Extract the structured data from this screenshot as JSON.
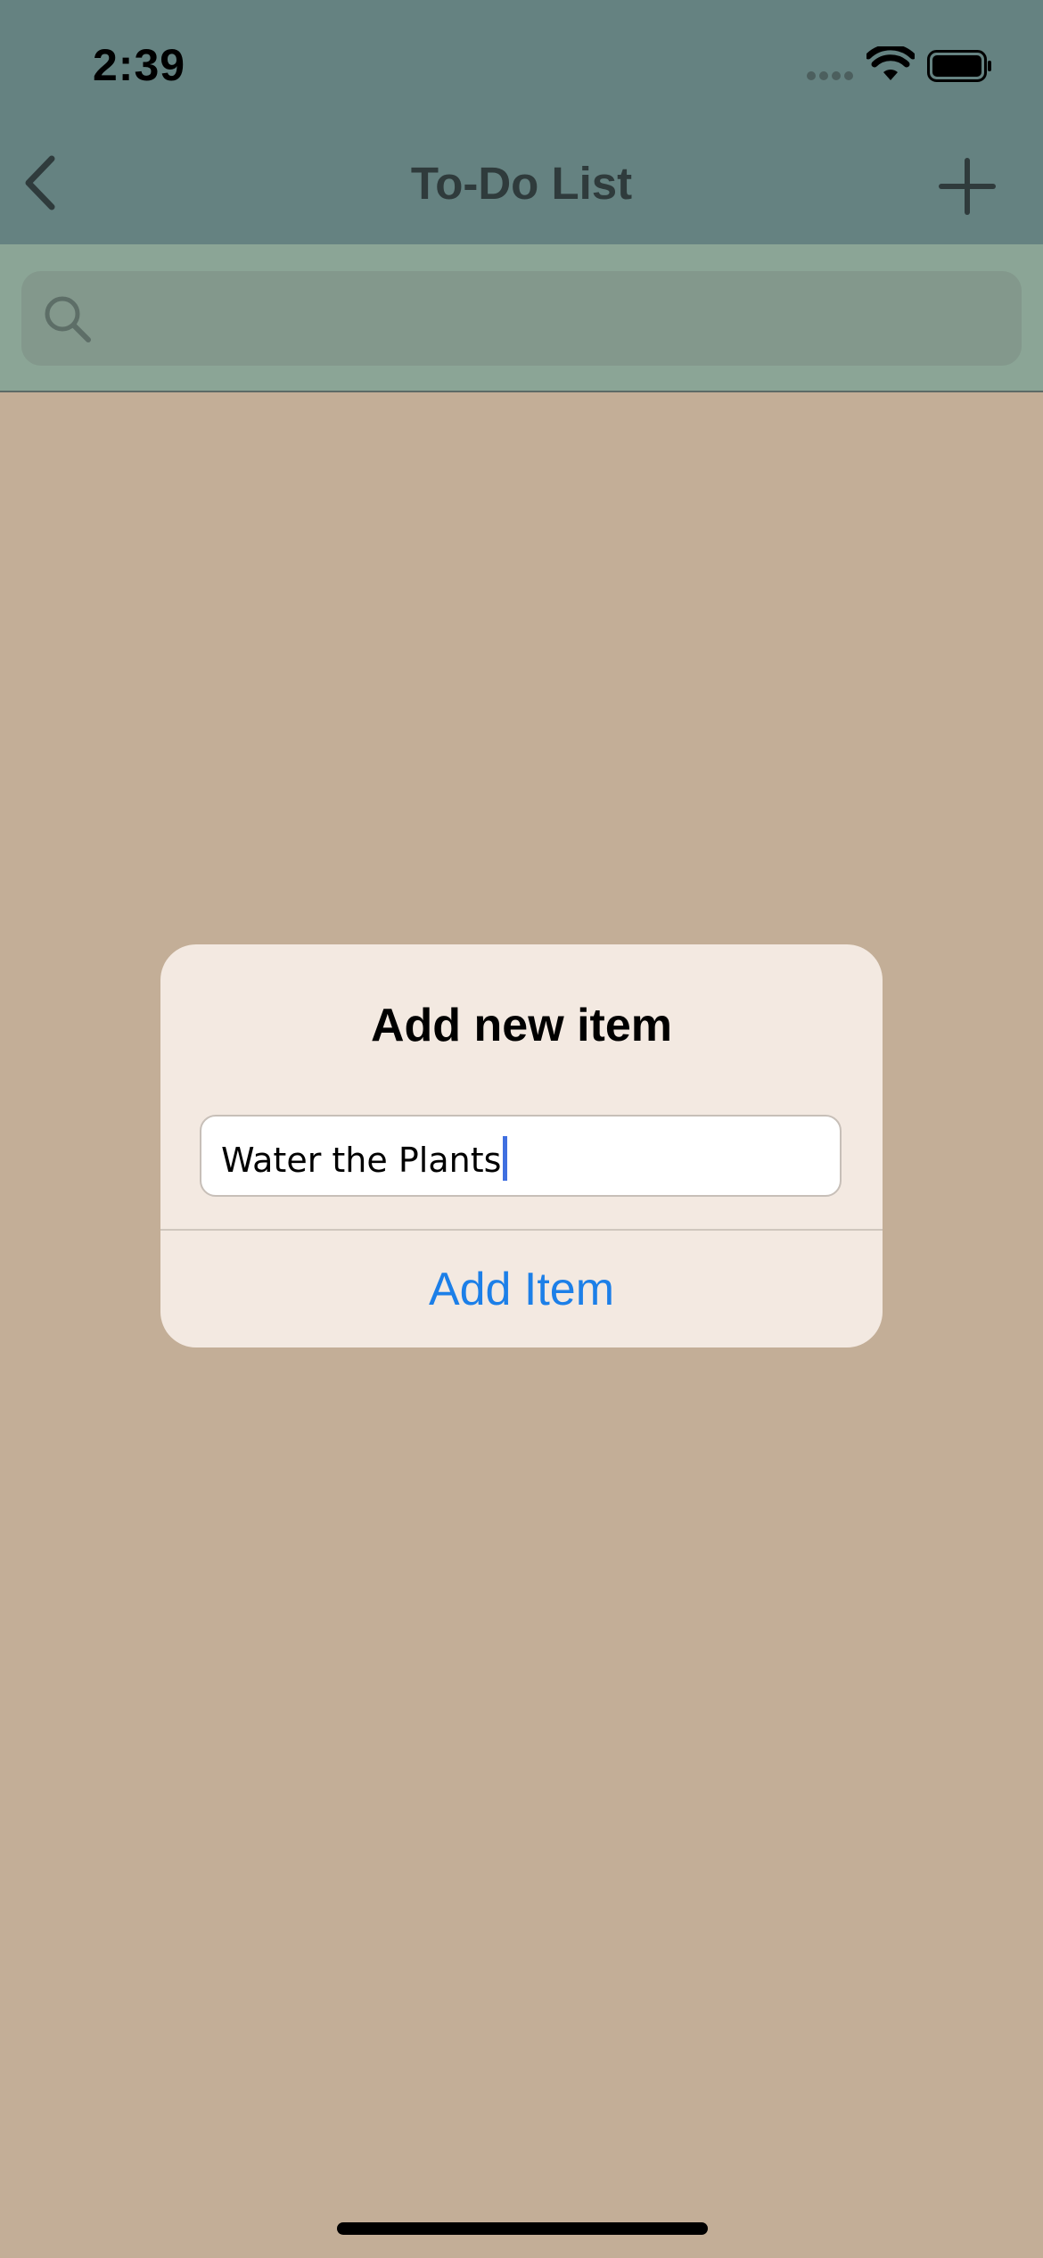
{
  "status_bar": {
    "time": "2:39",
    "icons": [
      "signal-dots-icon",
      "wifi-icon",
      "battery-icon"
    ]
  },
  "nav": {
    "title": "To-Do List",
    "back_icon": "chevron-left-icon",
    "add_icon": "plus-icon"
  },
  "search": {
    "icon": "search-icon",
    "placeholder": "",
    "value": ""
  },
  "alert": {
    "title": "Add new item",
    "field_value": "Water the Plants",
    "action_label": "Add Item"
  },
  "colors": {
    "header_bg": "#658281",
    "search_bar_bg": "#8ba596",
    "page_bg": "#c3ae97",
    "alert_bg": "#f3e9e1",
    "accent": "#1c7fe8",
    "caret": "#3f6fe0"
  }
}
